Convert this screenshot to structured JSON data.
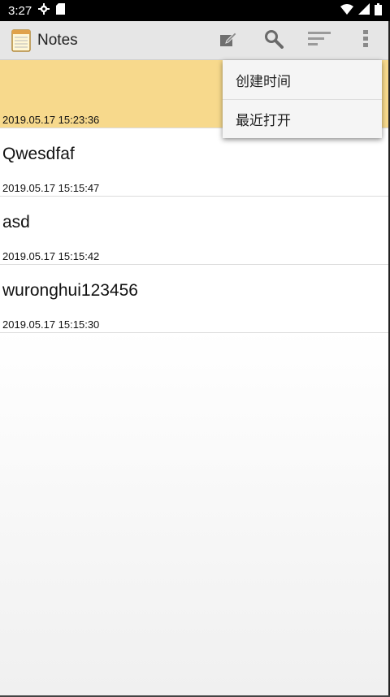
{
  "status_bar": {
    "time": "3:27",
    "icons": [
      "gear-icon",
      "sd-card-icon",
      "wifi-icon",
      "signal-icon",
      "battery-icon"
    ]
  },
  "app_bar": {
    "title": "Notes",
    "actions": [
      "new-note-icon",
      "search-icon",
      "sort-icon",
      "overflow-menu-icon"
    ]
  },
  "notes": [
    {
      "title": "",
      "time": "2019.05.17 15:23:36",
      "highlight": true
    },
    {
      "title": "Qwesdfaf",
      "time": "2019.05.17 15:15:47"
    },
    {
      "title": "asd",
      "time": "2019.05.17 15:15:42"
    },
    {
      "title": "wuronghui123456",
      "time": "2019.05.17 15:15:30"
    }
  ],
  "sort_menu": {
    "items": [
      "创建时间",
      "最近打开"
    ]
  },
  "colors": {
    "highlight_row": "#f7d98c",
    "app_bar": "#e6e6e6"
  }
}
